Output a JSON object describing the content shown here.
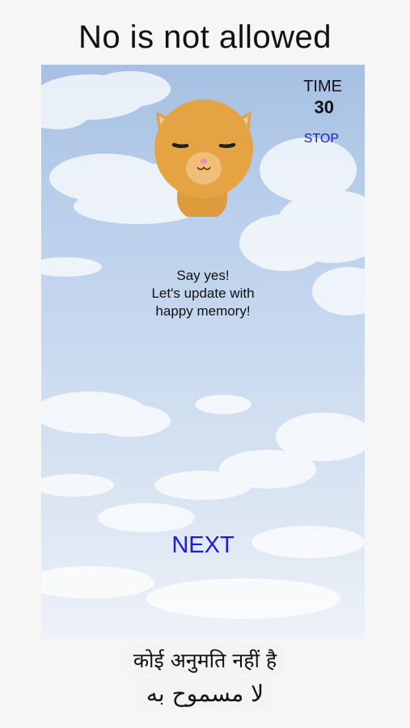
{
  "headline": "No is not allowed",
  "game": {
    "timer_label": "TIME",
    "timer_value": "30",
    "stop_label": "STOP",
    "message_lines": [
      "Say yes!",
      "Let's update with",
      "happy memory!"
    ],
    "next_label": "NEXT"
  },
  "subtitles": {
    "hindi": "कोई अनुमति नहीं है",
    "arabic": "لا مسموح به"
  },
  "colors": {
    "button_text": "#1a1ae0",
    "sky_top": "#a7c0e2",
    "cat_fur": "#e5a343"
  },
  "icons": {
    "character": "sleepy-cat-icon"
  }
}
